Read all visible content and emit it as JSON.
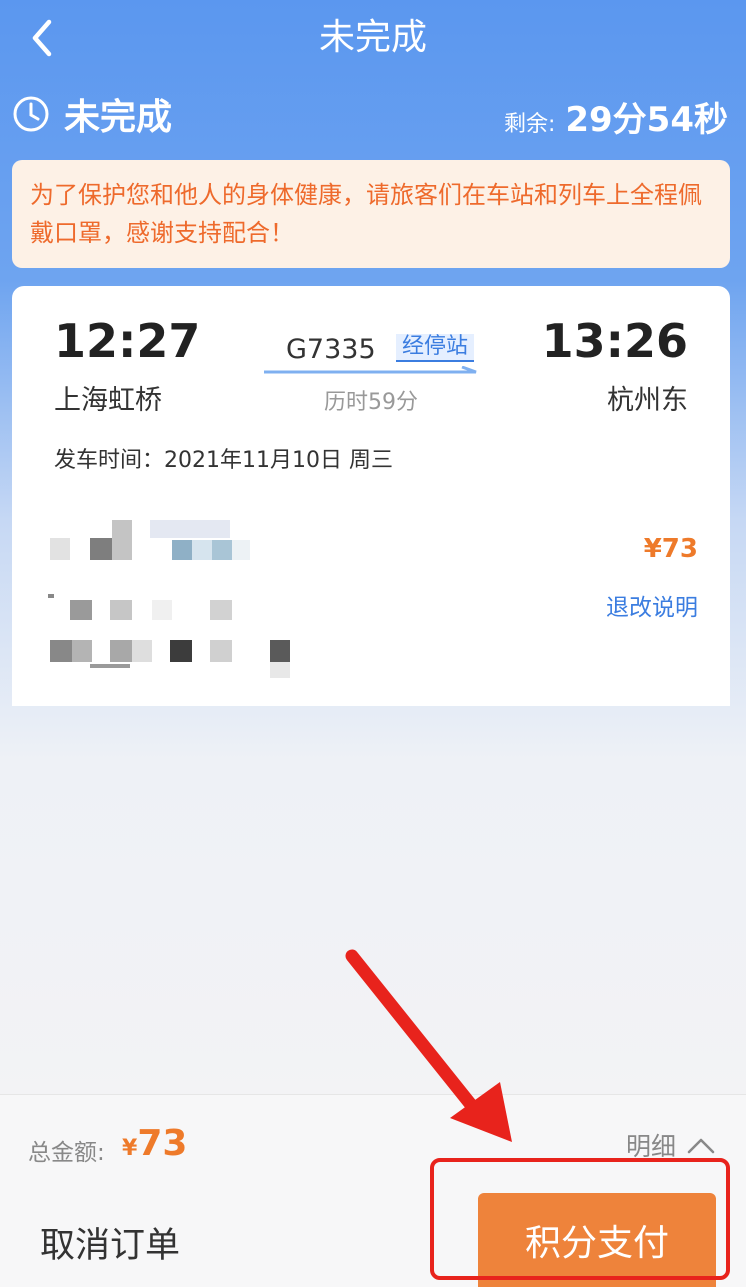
{
  "header": {
    "title": "未完成"
  },
  "status": {
    "label": "未完成",
    "remaining_label": "剩余:",
    "remaining_time": "29分54秒"
  },
  "notice": {
    "text": "为了保护您和他人的身体健康，请旅客们在车站和列车上全程佩戴口罩，感谢支持配合！"
  },
  "train": {
    "departure_time": "12:27",
    "arrival_time": "13:26",
    "departure_station": "上海虹桥",
    "arrival_station": "杭州东",
    "train_number": "G7335",
    "stops_label": "经停站",
    "duration": "历时59分",
    "departure_date": "发车时间：2021年11月10日 周三"
  },
  "passenger": {
    "price": "¥73",
    "refund_label": "退改说明"
  },
  "bottom": {
    "total_label": "总金额:",
    "currency": "¥",
    "total_amount": "73",
    "detail_label": "明细",
    "cancel_label": "取消订单",
    "pay_label": "积分支付"
  },
  "colors": {
    "header_blue": "#5b97ef",
    "accent_orange": "#ee7a2a",
    "link_blue": "#3b7de0",
    "annotation_red": "#e8231c"
  },
  "icons": {
    "back": "chevron-left-icon",
    "clock": "clock-icon",
    "expand": "chevron-up-icon"
  }
}
